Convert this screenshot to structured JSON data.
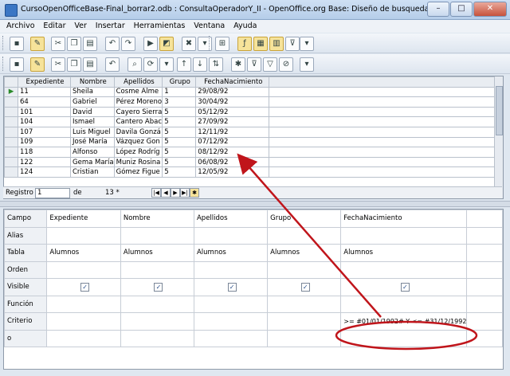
{
  "window": {
    "title": "CursoOpenOfficeBase-Final_borrar2.odb : ConsultaOperadorY_II - OpenOffice.org Base: Diseño de busqueda",
    "minimize": "–",
    "maximize": "□",
    "close": "✕"
  },
  "menu": [
    "Archivo",
    "Editar",
    "Ver",
    "Insertar",
    "Herramientas",
    "Ventana",
    "Ayuda"
  ],
  "results": {
    "headers": [
      "Expediente",
      "Nombre",
      "Apellidos",
      "Grupo",
      "FechaNacimiento"
    ],
    "rows": [
      [
        "11",
        "Sheila",
        "Cosme Alme",
        "1",
        "29/08/92"
      ],
      [
        "64",
        "Gabriel",
        "Pérez Moreno",
        "3",
        "30/04/92"
      ],
      [
        "101",
        "David",
        "Cayero Sierra",
        "5",
        "05/12/92"
      ],
      [
        "104",
        "Ismael",
        "Cantero Abac",
        "5",
        "27/09/92"
      ],
      [
        "107",
        "Luis Miguel",
        "Davila Gonzá",
        "5",
        "12/11/92"
      ],
      [
        "109",
        "José María",
        "Vázquez Gon",
        "5",
        "07/12/92"
      ],
      [
        "118",
        "Alfonso",
        "López Rodríg",
        "5",
        "08/12/92"
      ],
      [
        "122",
        "Gema María",
        "Muniz Rosina",
        "5",
        "06/08/92"
      ],
      [
        "124",
        "Cristian",
        "Gómez Figue",
        "5",
        "12/05/92"
      ]
    ]
  },
  "navigation": {
    "record_label": "Registro",
    "record_value": "1",
    "of_label": "de",
    "total": "13 *"
  },
  "design": {
    "row_labels": [
      "Campo",
      "Alias",
      "Tabla",
      "Orden",
      "Visible",
      "Función",
      "Criterio",
      "o"
    ],
    "columns": [
      {
        "campo": "Expediente",
        "tabla": "Alumnos",
        "visible": true,
        "criterio": ""
      },
      {
        "campo": "Nombre",
        "tabla": "Alumnos",
        "visible": true,
        "criterio": ""
      },
      {
        "campo": "Apellidos",
        "tabla": "Alumnos",
        "visible": true,
        "criterio": ""
      },
      {
        "campo": "Grupo",
        "tabla": "Alumnos",
        "visible": true,
        "criterio": ""
      },
      {
        "campo": "FechaNacimiento",
        "tabla": "Alumnos",
        "visible": true,
        "criterio": ">= #01/01/1992# Y <= #31/12/1992"
      }
    ]
  },
  "colors": {
    "annotation": "#c0151b"
  }
}
